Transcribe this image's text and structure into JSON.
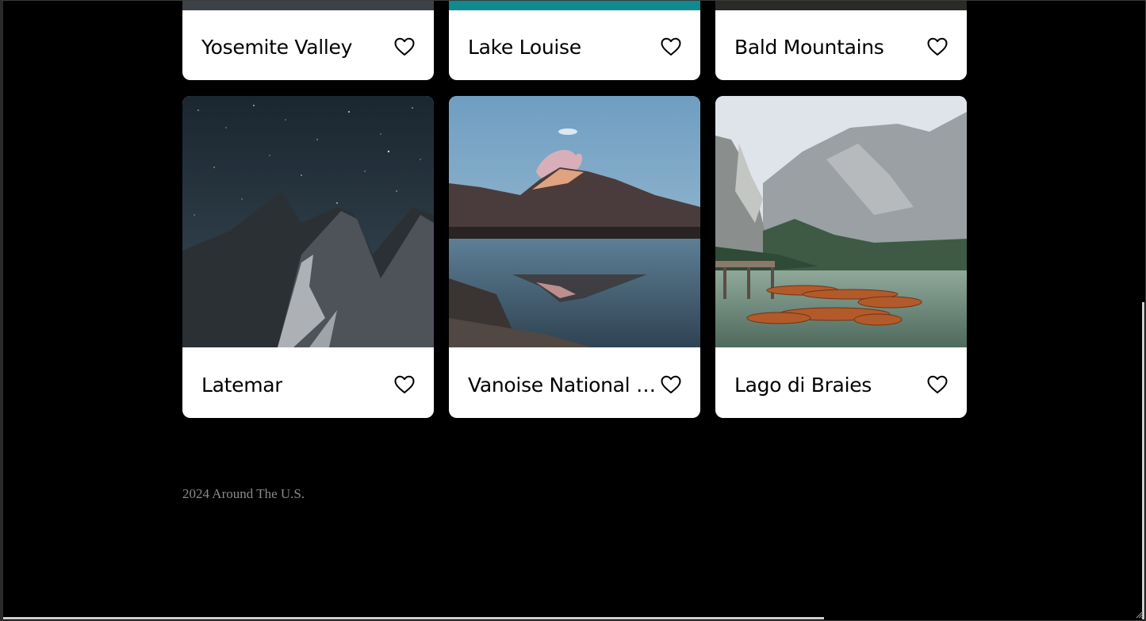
{
  "cards": [
    {
      "title": "Yosemite Valley",
      "image": "yosemite-valley-photo"
    },
    {
      "title": "Lake Louise",
      "image": "lake-louise-photo"
    },
    {
      "title": "Bald Mountains",
      "image": "bald-mountains-photo"
    },
    {
      "title": "Latemar",
      "image": "latemar-photo"
    },
    {
      "title": "Vanoise National Park",
      "image": "vanoise-national-park-photo"
    },
    {
      "title": "Lago di Braies",
      "image": "lago-di-braies-photo"
    }
  ],
  "footer": {
    "copyright": "2024 Around The U.S."
  },
  "icons": {
    "like": "heart-outline-icon"
  },
  "colors": {
    "page_background": "#000000",
    "card_background": "#ffffff",
    "footer_text": "#8a8a8a"
  }
}
